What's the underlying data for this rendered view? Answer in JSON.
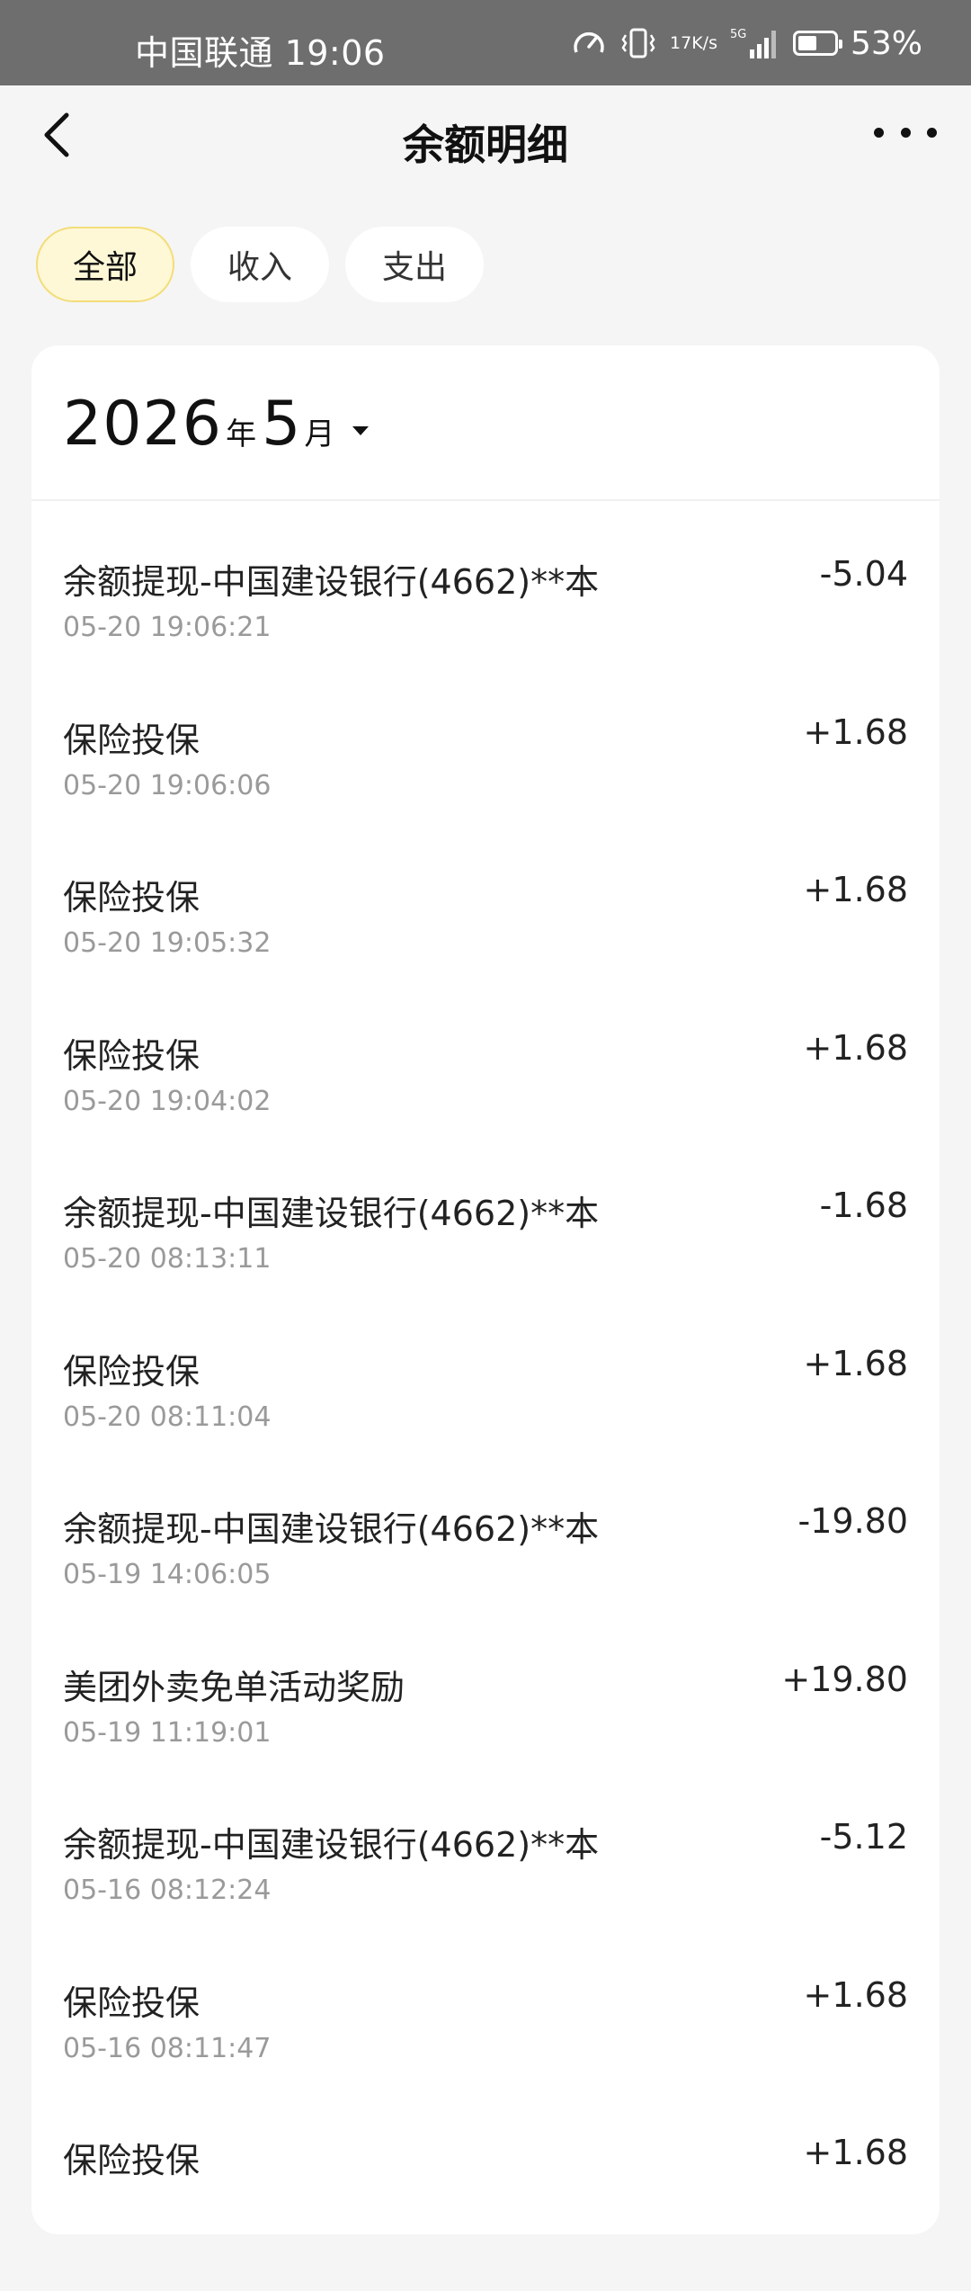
{
  "status_bar": {
    "carrier_time": "中国联通 19:06",
    "net_speed_value": "17",
    "net_speed_unit": "K/s",
    "signal_label": "5G",
    "battery_percent": "53%",
    "battery_level": 0.53
  },
  "header": {
    "title": "余额明细"
  },
  "tabs": [
    {
      "label": "全部",
      "active": true
    },
    {
      "label": "收入",
      "active": false
    },
    {
      "label": "支出",
      "active": false
    }
  ],
  "filter": {
    "year": "2026",
    "year_unit": "年",
    "month": "5",
    "month_unit": "月"
  },
  "transactions": [
    {
      "title": "余额提现-中国建设银行(4662)**本",
      "time": "05-20 19:06:21",
      "amount": "-5.04"
    },
    {
      "title": "保险投保",
      "time": "05-20 19:06:06",
      "amount": "+1.68"
    },
    {
      "title": "保险投保",
      "time": "05-20 19:05:32",
      "amount": "+1.68"
    },
    {
      "title": "保险投保",
      "time": "05-20 19:04:02",
      "amount": "+1.68"
    },
    {
      "title": "余额提现-中国建设银行(4662)**本",
      "time": "05-20 08:13:11",
      "amount": "-1.68"
    },
    {
      "title": "保险投保",
      "time": "05-20 08:11:04",
      "amount": "+1.68"
    },
    {
      "title": "余额提现-中国建设银行(4662)**本",
      "time": "05-19 14:06:05",
      "amount": "-19.80"
    },
    {
      "title": "美团外卖免单活动奖励",
      "time": "05-19 11:19:01",
      "amount": "+19.80"
    },
    {
      "title": "余额提现-中国建设银行(4662)**本",
      "time": "05-16 08:12:24",
      "amount": "-5.12"
    },
    {
      "title": "保险投保",
      "time": "05-16 08:11:47",
      "amount": "+1.68"
    },
    {
      "title": "保险投保",
      "time": "",
      "amount": "+1.68"
    }
  ]
}
